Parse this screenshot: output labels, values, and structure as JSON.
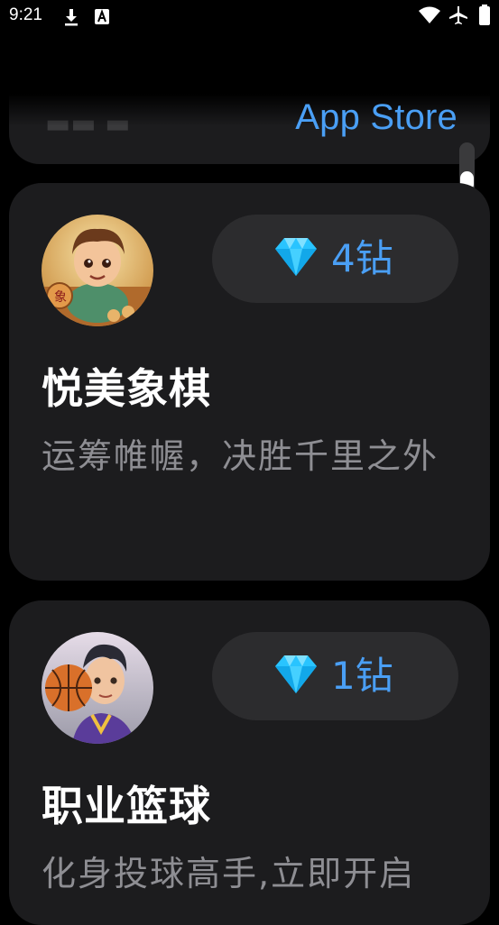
{
  "status_bar": {
    "time": "9:21",
    "icons": [
      "download-icon",
      "text-notification-icon",
      "wifi-icon",
      "airplane-mode-icon",
      "battery-icon"
    ]
  },
  "previous_card": {
    "link_label": "App Store"
  },
  "games": [
    {
      "title": "悦美象棋",
      "description": "运筹帷幄，决胜千里之外",
      "price": "4钻",
      "price_icon": "diamond-icon",
      "avatar": "chess-player-avatar"
    },
    {
      "title": "职业篮球",
      "description": "化身投球高手,立即开启",
      "price": "1钻",
      "price_icon": "diamond-icon",
      "avatar": "basketball-player-avatar"
    }
  ],
  "colors": {
    "background": "#000000",
    "card": "#1c1c1e",
    "pill": "#2c2c2e",
    "accent": "#4a9ff5",
    "secondary_text": "#8e8e93",
    "diamond": "#29c4ff"
  }
}
